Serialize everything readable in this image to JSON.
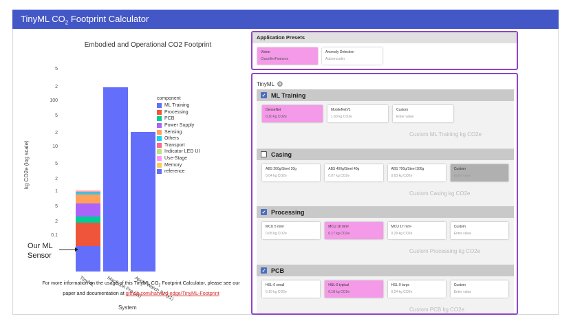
{
  "header": {
    "title_pre": "TinyML CO",
    "title_sub": "2",
    "title_post": " Footprint Calculator"
  },
  "chart_data": {
    "type": "bar",
    "title": "Embodied and Operational CO2 Footprint",
    "xlabel": "System",
    "ylabel": "kg CO2e (log scale)",
    "y_scale": "log",
    "categories": [
      "TinyML",
      "MacBook Pro (x1)",
      "Apple Watch S7 (x1)"
    ],
    "y_tick_labels": [
      "5",
      "2",
      "100",
      "5",
      "2",
      "10",
      "5",
      "2",
      "1",
      "5",
      "2",
      "0.1"
    ],
    "stacked": true,
    "series": [
      {
        "name": "ML Training",
        "color": "#636efa",
        "values": [
          0.12,
          0,
          0
        ]
      },
      {
        "name": "Processing",
        "color": "#ef553b",
        "values": [
          0.35,
          0,
          0
        ]
      },
      {
        "name": "PCB",
        "color": "#00cc96",
        "values": [
          0.18,
          0,
          0
        ]
      },
      {
        "name": "Power Supply",
        "color": "#ab63fa",
        "values": [
          0.6,
          0,
          0
        ]
      },
      {
        "name": "Sensing",
        "color": "#ffa15a",
        "values": [
          0.7,
          0,
          0
        ]
      },
      {
        "name": "Others",
        "color": "#19d3f3",
        "values": [
          0.2,
          0,
          0
        ]
      },
      {
        "name": "Transport",
        "color": "#ff6692",
        "values": [
          0.1,
          0,
          0
        ]
      },
      {
        "name": "Indicator LED UI",
        "color": "#b6e880",
        "values": [
          0.05,
          0,
          0
        ]
      },
      {
        "name": "Use-Stage",
        "color": "#ff97ff",
        "values": [
          0.05,
          0,
          0
        ]
      },
      {
        "name": "Memory",
        "color": "#fecb52",
        "values": [
          0.05,
          0,
          0
        ]
      },
      {
        "name": "reference",
        "color": "#636efa",
        "values": [
          0,
          350,
          40
        ]
      }
    ],
    "legend_title": "component",
    "legend_placement": "right"
  },
  "annotation": {
    "line1": "Our ML",
    "line2": "Sensor"
  },
  "info": {
    "text1": "For more information on the usage of this TinyML CO",
    "sub": "2",
    "text2": " Footprint Calculator, please see our paper and documentation at ",
    "link": "github.com/harvard-edge/TinyML-Footprint"
  },
  "presets": {
    "title": "Application Presets",
    "items": [
      {
        "label": "Vision",
        "sub": "ClassifierFeatures",
        "selected": true
      },
      {
        "label": "Anomaly Detection",
        "sub": "Autoencoder",
        "selected": false
      }
    ]
  },
  "config": {
    "label": "TinyML",
    "sections": [
      {
        "title": "ML Training",
        "checked": true,
        "custom_placeholder": "Custom ML Training kg CO2e",
        "cards": [
          {
            "label": "DenseNet",
            "sub": "0.10 kg CO2e",
            "state": "sel"
          },
          {
            "label": "MobileNetV1",
            "sub": "1.60 kg CO2e",
            "state": ""
          },
          {
            "label": "Custom",
            "sub": "Enter value",
            "state": ""
          }
        ]
      },
      {
        "title": "Casing",
        "checked": false,
        "custom_placeholder": "Custom Casing kg CO2e",
        "cards": [
          {
            "label": "ABS 200g/Steel 20g",
            "sub": "0.04 kg CO2e",
            "state": ""
          },
          {
            "label": "ABS 400g/Steel 40g",
            "sub": "0.07 kg CO2e",
            "state": ""
          },
          {
            "label": "ABS 700g/Steel 300g",
            "sub": "0.63 kg CO2e",
            "state": ""
          },
          {
            "label": "Custom",
            "sub": "Enter value",
            "state": "gray"
          }
        ]
      },
      {
        "title": "Processing",
        "checked": true,
        "custom_placeholder": "Custom Processing kg CO2e",
        "cards": [
          {
            "label": "MCU 5 mm²",
            "sub": "0.08 kg CO2e",
            "state": ""
          },
          {
            "label": "MCU 10 mm²",
            "sub": "0.17 kg CO2e",
            "state": "sel"
          },
          {
            "label": "MCU 17 mm²",
            "sub": "0.29 kg CO2e",
            "state": ""
          },
          {
            "label": "Custom",
            "sub": "Enter value",
            "state": ""
          }
        ]
      },
      {
        "title": "PCB",
        "checked": true,
        "custom_placeholder": "Custom PCB kg CO2e",
        "cards": [
          {
            "label": "HSL-0 small",
            "sub": "0.10 kg CO2e",
            "state": ""
          },
          {
            "label": "HSL-0 typical",
            "sub": "0.18 kg CO2e",
            "state": "sel"
          },
          {
            "label": "HSL-0 large",
            "sub": "0.24 kg CO2e",
            "state": ""
          },
          {
            "label": "Custom",
            "sub": "Enter value",
            "state": ""
          }
        ]
      }
    ]
  }
}
